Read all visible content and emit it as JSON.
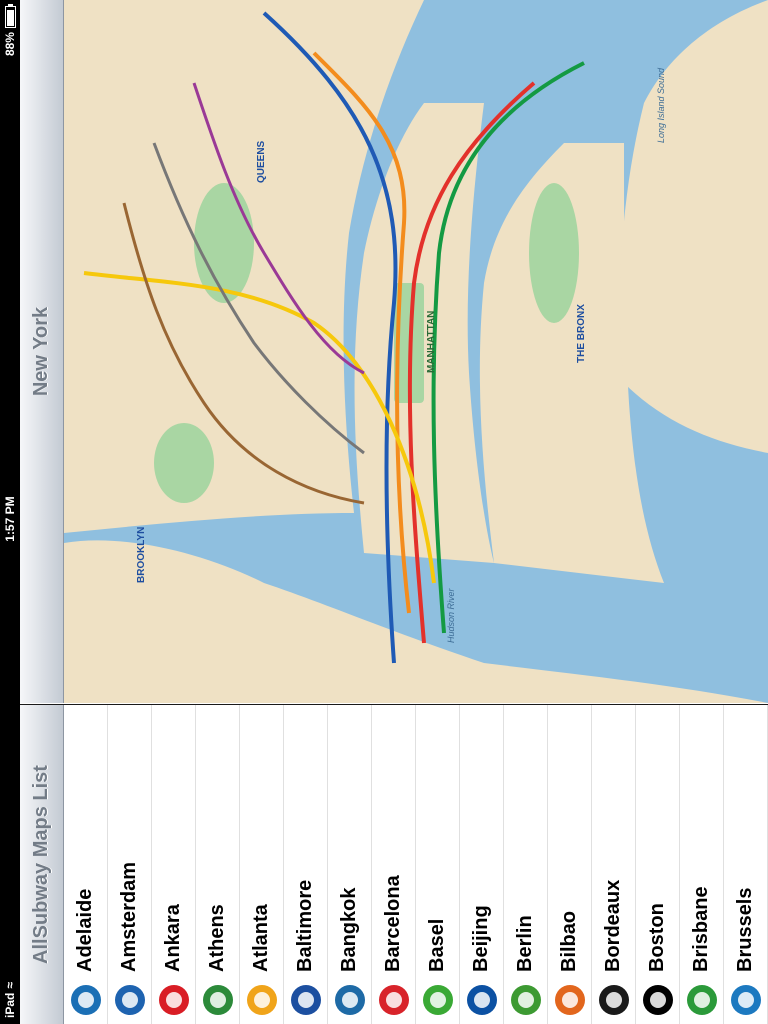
{
  "status_bar": {
    "device": "iPad",
    "time": "1:57 PM",
    "battery_text": "88%",
    "battery_level": 0.88
  },
  "master": {
    "title": "AllSubway Maps List",
    "items": [
      {
        "name": "Adelaide",
        "logo": "adelaide-logo",
        "color": "#1b6fb5"
      },
      {
        "name": "Amsterdam",
        "logo": "gvb-logo",
        "color": "#1e63b0"
      },
      {
        "name": "Ankara",
        "logo": "ankara-m-logo",
        "color": "#d91d25"
      },
      {
        "name": "Athens",
        "logo": "athens-logo",
        "color": "#2c8a3a"
      },
      {
        "name": "Atlanta",
        "logo": "marta-logo",
        "color": "#f0a41a"
      },
      {
        "name": "Baltimore",
        "logo": "baltimore-m-logo",
        "color": "#1c4fa0"
      },
      {
        "name": "Bangkok",
        "logo": "bangkok-mrt-logo",
        "color": "#1e6aa6"
      },
      {
        "name": "Barcelona",
        "logo": "barcelona-m-logo",
        "color": "#d8232a"
      },
      {
        "name": "Basel",
        "logo": "basel-tnw-logo",
        "color": "#3aa935"
      },
      {
        "name": "Beijing",
        "logo": "beijing-logo",
        "color": "#0c51a3"
      },
      {
        "name": "Berlin",
        "logo": "berlin-sbahn-logo",
        "color": "#3d9a32"
      },
      {
        "name": "Bilbao",
        "logo": "bilbao-logo",
        "color": "#e2661d"
      },
      {
        "name": "Bordeaux",
        "logo": "bordeaux-logo",
        "color": "#1a1a1a"
      },
      {
        "name": "Boston",
        "logo": "boston-t-logo",
        "color": "#000000"
      },
      {
        "name": "Brisbane",
        "logo": "brisbane-logo",
        "color": "#2b9a3a"
      },
      {
        "name": "Brussels",
        "logo": "brussels-m-logo",
        "color": "#1c79c0"
      }
    ]
  },
  "detail": {
    "title": "New York",
    "map_labels": {
      "manhattan": "MANHATTAN",
      "bronx": "THE BRONX",
      "queens": "QUEENS",
      "brooklyn": "BROOKLYN",
      "hudson": "Hudson River",
      "sound": "Long Island Sound"
    }
  },
  "colors": {
    "water": "#8fbfdf",
    "land": "#efe1c4",
    "park": "#a9d6a3",
    "accent_text": "#737c87"
  }
}
